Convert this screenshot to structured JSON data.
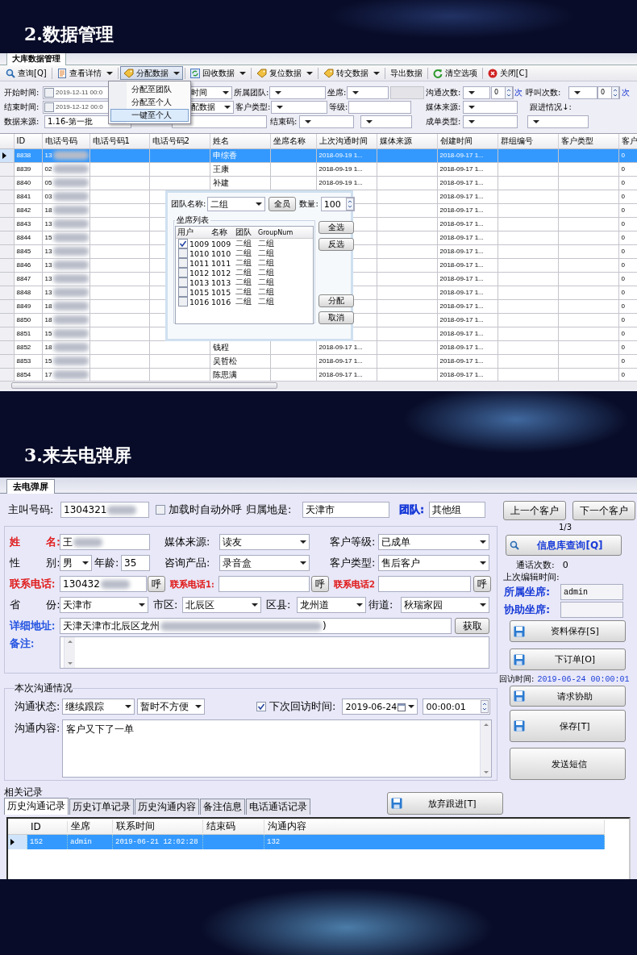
{
  "data_management": {
    "heading": "2.数据管理",
    "window": {
      "tabs": [
        {
          "label": "大库数据管理",
          "selected": true
        }
      ],
      "toolbar": [
        {
          "label": "查询[Q]",
          "dropdown": false,
          "pressed": false
        },
        {
          "label": "查看详情",
          "dropdown": true,
          "pressed": false
        },
        {
          "label": "分配数据",
          "dropdown": true,
          "pressed": true
        },
        {
          "label": "回收数据",
          "dropdown": true,
          "pressed": false
        },
        {
          "label": "复位数据",
          "dropdown": true,
          "pressed": false
        },
        {
          "label": "转交数据",
          "dropdown": true,
          "pressed": false
        },
        {
          "label": "导出数据",
          "dropdown": false,
          "pressed": false
        },
        {
          "label": "清空选项",
          "dropdown": false,
          "pressed": false
        },
        {
          "label": "关闭[C]",
          "dropdown": false,
          "pressed": false
        }
      ],
      "menu": [
        {
          "label": "分配至团队",
          "selected": false
        },
        {
          "label": "分配至个人",
          "selected": false
        },
        {
          "label": "一键至个人",
          "selected": true
        }
      ],
      "filters": [
        [
          {
            "kind": "label",
            "text": "开始时间:"
          },
          {
            "kind": "date",
            "value": "2019-12-11 00:0",
            "checked": false
          },
          {
            "kind": "select",
            "value": "时间"
          },
          {
            "kind": "label",
            "text": "所属团队:"
          },
          {
            "kind": "select"
          },
          {
            "kind": "label",
            "text": "坐席:"
          },
          {
            "kind": "select"
          },
          {
            "kind": "disabled"
          },
          {
            "kind": "label",
            "text": "沟通次数:"
          },
          {
            "kind": "select"
          },
          {
            "kind": "spin",
            "value": "0"
          },
          {
            "kind": "unit",
            "text": "次"
          },
          {
            "kind": "label",
            "text": "呼叫次数:"
          },
          {
            "kind": "select"
          },
          {
            "kind": "spin",
            "value": "0"
          },
          {
            "kind": "unit",
            "text": "次"
          }
        ],
        [
          {
            "kind": "label",
            "text": "结束时间:"
          },
          {
            "kind": "date",
            "value": "2019-12-12 00:0",
            "checked": false
          },
          {
            "kind": "select",
            "value": "配数据"
          },
          {
            "kind": "label",
            "text": "客户类型:"
          },
          {
            "kind": "select"
          },
          {
            "kind": "label",
            "text": "等级:"
          },
          {
            "kind": "input"
          },
          {
            "kind": "label",
            "text": "媒体来源:"
          },
          {
            "kind": "select"
          },
          {
            "kind": "label",
            "text": "跟进情况↓:"
          }
        ],
        [
          {
            "kind": "label",
            "text": "数据来源:"
          },
          {
            "kind": "input",
            "value": "1.16-第一批"
          },
          {
            "kind": "input"
          },
          {
            "kind": "label",
            "text": "结束码:"
          },
          {
            "kind": "select"
          },
          {
            "kind": "select"
          },
          {
            "kind": "label",
            "text": "成单类型:"
          },
          {
            "kind": "select"
          },
          {
            "kind": "select"
          }
        ]
      ],
      "table": {
        "columns": [
          "ID",
          "电话号码",
          "电话号码1",
          "电话号码2",
          "姓名",
          "坐席名称",
          "上次沟通时间",
          "媒体来源",
          "创建时间",
          "群组编号",
          "客户类型",
          "客户"
        ],
        "rows": [
          {
            "id": "8838",
            "phone": "13",
            "name": "申综香",
            "last_contact": "2018-09-19 1...",
            "created": "2018-09-17 1...",
            "column_12": "0",
            "selected": true
          },
          {
            "id": "8839",
            "phone": "02",
            "name": "王康",
            "last_contact": "2018-09-19 1...",
            "created": "2018-09-17 1...",
            "column_12": "0",
            "selected": false
          },
          {
            "id": "8840",
            "phone": "05",
            "name": "补建",
            "last_contact": "2018-09-19 1...",
            "created": "2018-09-17 1...",
            "column_12": "0",
            "selected": false
          },
          {
            "id": "8841",
            "phone": "03",
            "created": "2018-09-17 1...",
            "column_12": "0",
            "selected": false
          },
          {
            "id": "8842",
            "phone": "18",
            "created": "2018-09-17 1...",
            "column_12": "0",
            "selected": false
          },
          {
            "id": "8843",
            "phone": "13",
            "created": "2018-09-17 1...",
            "column_12": "0",
            "selected": false
          },
          {
            "id": "8844",
            "phone": "15",
            "created": "2018-09-17 1...",
            "column_12": "0",
            "selected": false
          },
          {
            "id": "8845",
            "phone": "13",
            "created": "2018-09-17 1...",
            "column_12": "0",
            "selected": false
          },
          {
            "id": "8846",
            "phone": "13",
            "created": "2018-09-17 1...",
            "column_12": "0",
            "selected": false
          },
          {
            "id": "8847",
            "phone": "13",
            "created": "2018-09-17 1...",
            "column_12": "0",
            "selected": false
          },
          {
            "id": "8848",
            "phone": "13",
            "created": "2018-09-17 1...",
            "column_12": "0",
            "selected": false
          },
          {
            "id": "8849",
            "phone": "18",
            "created": "2018-09-17 1...",
            "column_12": "0",
            "selected": false
          },
          {
            "id": "8850",
            "phone": "18",
            "created": "2018-09-17 1...",
            "column_12": "0",
            "selected": false
          },
          {
            "id": "8851",
            "phone": "15",
            "created": "2018-09-17 1...",
            "column_12": "0",
            "selected": false
          },
          {
            "id": "8852",
            "phone": "18",
            "name": "钱程",
            "last_contact": "2018-09-17 1...",
            "created": "2018-09-17 1...",
            "column_12": "0",
            "selected": false
          },
          {
            "id": "8853",
            "phone": "15",
            "name": "吴哲松",
            "last_contact": "2018-09-17 1...",
            "created": "2018-09-17 1...",
            "column_12": "0",
            "selected": false
          },
          {
            "id": "8854",
            "phone": "17",
            "name": "陈思满",
            "last_contact": "2018-09-17 1...",
            "created": "2018-09-17 1...",
            "column_12": "0",
            "selected": false
          }
        ]
      },
      "dialog": {
        "team_label": "团队名称:",
        "team": "二组",
        "all_button": "全员",
        "count_label": "数量:",
        "count": "100",
        "list_title": "坐席列表",
        "columns": [
          "用户",
          "名称",
          "团队",
          "GroupNum"
        ],
        "rows": [
          {
            "user": "1009",
            "name": "1009",
            "team": "二组",
            "group_num": "二组",
            "checked": true
          },
          {
            "user": "1010",
            "name": "1010",
            "team": "二组",
            "group_num": "二组",
            "checked": false
          },
          {
            "user": "1011",
            "name": "1011",
            "team": "二组",
            "group_num": "二组",
            "checked": false
          },
          {
            "user": "1012",
            "name": "1012",
            "team": "二组",
            "group_num": "二组",
            "checked": false
          },
          {
            "user": "1013",
            "name": "1013",
            "team": "二组",
            "group_num": "二组",
            "checked": false
          },
          {
            "user": "1015",
            "name": "1015",
            "team": "二组",
            "group_num": "二组",
            "checked": false
          },
          {
            "user": "1016",
            "name": "1016",
            "team": "二组",
            "group_num": "二组",
            "checked": false
          }
        ],
        "buttons": [
          "全选",
          "反选",
          "分配",
          "取消"
        ]
      }
    }
  },
  "call_popup": {
    "heading": "3.来去电弹屏",
    "window": {
      "tabs": [
        {
          "label": "去电弹屏",
          "selected": true
        }
      ],
      "top_row": [
        {
          "kind": "label",
          "text": "主叫号码:"
        },
        {
          "kind": "input",
          "value": "1304321",
          "redacted": true
        },
        {
          "kind": "checkbox",
          "text": "加载时自动外呼",
          "checked": false
        },
        {
          "kind": "label",
          "text": "归属地是:"
        },
        {
          "kind": "input",
          "value": "天津市",
          "redacted": false
        },
        {
          "kind": "label",
          "text": "团队:",
          "color": "#1a3cd8"
        },
        {
          "kind": "input",
          "value": "其他组",
          "redacted": false
        }
      ],
      "form_rows": [
        [
          {
            "kind": "label",
            "text": "姓 名:",
            "color": "#e01818"
          },
          {
            "kind": "input",
            "value": "王",
            "redacted": true
          },
          {
            "kind": "label",
            "text": "媒体来源:"
          },
          {
            "kind": "select",
            "value": "读友"
          },
          {
            "kind": "label",
            "text": "客户等级:"
          },
          {
            "kind": "select",
            "value": "已成单"
          }
        ],
        [
          {
            "kind": "label",
            "text": "性 别:"
          },
          {
            "kind": "select",
            "value": "男"
          },
          {
            "kind": "label",
            "text": "年龄:"
          },
          {
            "kind": "input",
            "value": "35",
            "redacted": false
          },
          {
            "kind": "label",
            "text": "咨询产品:"
          },
          {
            "kind": "select",
            "value": "录音盒"
          },
          {
            "kind": "label",
            "text": "客户类型:"
          },
          {
            "kind": "select",
            "value": "售后客户"
          }
        ],
        [
          {
            "kind": "label",
            "text": "联系电话:",
            "color": "#e01818"
          },
          {
            "kind": "input",
            "value": "130432",
            "redacted": true
          },
          {
            "kind": "button",
            "text": "呼"
          },
          {
            "kind": "label",
            "text": "联系电话1:",
            "color": "#e01818"
          },
          {
            "kind": "input",
            "redacted": false
          },
          {
            "kind": "button",
            "text": "呼"
          },
          {
            "kind": "label",
            "text": "联系电话2",
            "color": "#e01818"
          },
          {
            "kind": "input",
            "redacted": false
          },
          {
            "kind": "button",
            "text": "呼"
          }
        ],
        [
          {
            "kind": "label",
            "text": "省 份:"
          },
          {
            "kind": "select",
            "value": "天津市"
          },
          {
            "kind": "label",
            "text": "市区:"
          },
          {
            "kind": "select",
            "value": "北辰区"
          },
          {
            "kind": "label",
            "text": "区县:"
          },
          {
            "kind": "select",
            "value": "龙州道"
          },
          {
            "kind": "label",
            "text": "街道:"
          },
          {
            "kind": "select",
            "value": "秋瑞家园"
          }
        ],
        [
          {
            "kind": "label",
            "text": "详细地址:",
            "color": "#1f50e0"
          },
          {
            "kind": "input",
            "value": "天津天津市北辰区龙州",
            "redacted": true,
            "tail": ")"
          },
          {
            "kind": "button",
            "text": "获取"
          }
        ],
        [
          {
            "kind": "label",
            "text": "备注:",
            "color": "#1f50e0"
          },
          {
            "kind": "textarea"
          }
        ]
      ],
      "side": {
        "nav_buttons": [
          "上一个客户",
          "下一个客户"
        ],
        "page": "1/3",
        "query_button": "信息库查询[Q]",
        "call_count_label": "通话次数:",
        "call_count": "0",
        "last_edit_label": "上次编辑时间:",
        "owner_label": "所属坐席:",
        "owner": "admin",
        "assist_label": "协助坐席:",
        "save_button": "资料保存[S]",
        "order_button": "下订单[O]",
        "revisit_label": "回访时间:",
        "revisit": "2019-06-24 00:00:01",
        "assist_button": "请求协助",
        "save2_button": "保存[T]",
        "sms_button": "发送短信"
      },
      "communication": {
        "title": "本次沟通情况",
        "status_label": "沟通状态:",
        "status": "继续跟踪",
        "reason": "暂时不方便",
        "next_visit_label": "下次回访时间:",
        "next_visit_checked": true,
        "date": "2019-06-24",
        "time": "00:00:01",
        "content_label": "沟通内容:",
        "content": "客户又下了一单"
      },
      "records": {
        "title": "相关记录",
        "tabs": [
          {
            "label": "历史沟通记录",
            "selected": true
          },
          {
            "label": "历史订单记录",
            "selected": false
          },
          {
            "label": "历史沟通内容",
            "selected": false
          },
          {
            "label": "备注信息",
            "selected": false
          },
          {
            "label": "电话通话记录",
            "selected": false
          }
        ],
        "abandon_button": "放弃跟进[T]",
        "columns": [
          "ID",
          "坐席",
          "联系时间",
          "结束码",
          "沟通内容"
        ],
        "rows": [
          {
            "id": "152",
            "agent": "admin",
            "time": "2019-06-21 12:02:28",
            "content": "132",
            "selected": true
          }
        ]
      }
    }
  }
}
